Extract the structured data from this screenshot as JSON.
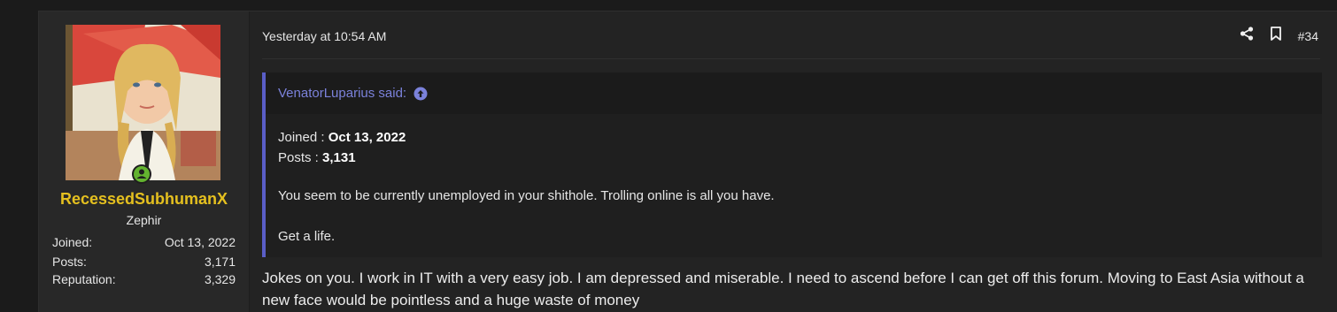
{
  "user": {
    "username": "RecessedSubhumanX",
    "user_title": "Zephir",
    "stats": [
      {
        "label": "Joined:",
        "value": "Oct 13, 2022"
      },
      {
        "label": "Posts:",
        "value": "3,171"
      },
      {
        "label": "Reputation:",
        "value": "3,329"
      }
    ],
    "online_icon": "user-online-icon",
    "username_color": "#e5c01f"
  },
  "post": {
    "date": "Yesterday at 10:54 AM",
    "number": "#34",
    "share_icon": "share-icon",
    "bookmark_icon": "bookmark-icon"
  },
  "quote": {
    "author_said": "VenatorLuparius said:",
    "expand_icon": "arrow-up-circle-icon",
    "joined_label": "Joined : ",
    "joined_value": "Oct 13, 2022",
    "posts_label": "Posts : ",
    "posts_value": "3,131",
    "line1": "You seem to be currently unemployed in your shithole. Trolling online is all you have.",
    "line2": "Get a life.",
    "accent": "#5a5ec7"
  },
  "message": {
    "text": "Jokes on you. I work in IT with a very easy job. I am depressed and miserable. I need to ascend before I can get off this forum. Moving to East Asia without a new face would be pointless and a huge waste of money"
  }
}
